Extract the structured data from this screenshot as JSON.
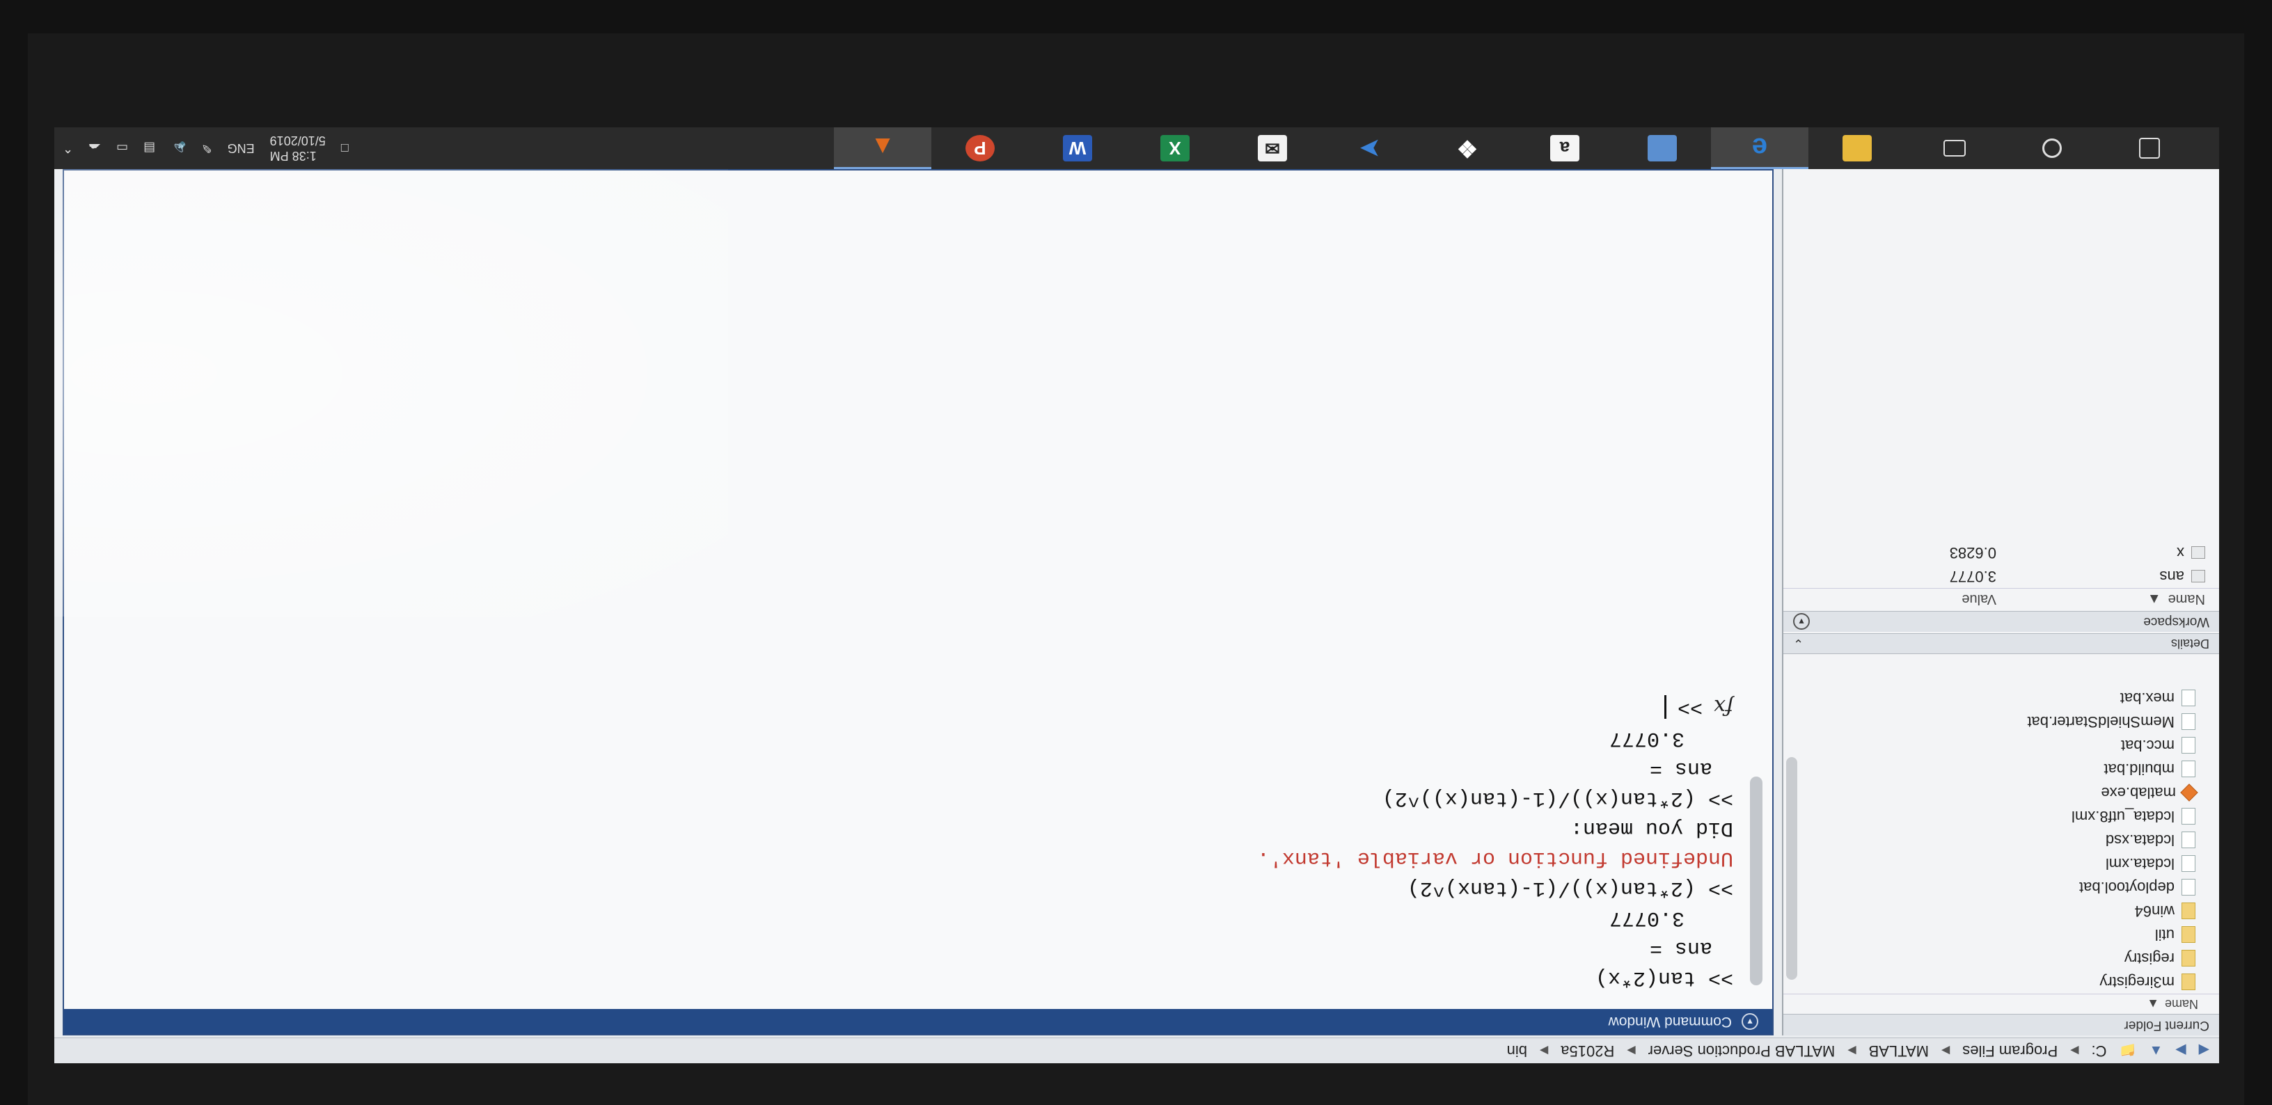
{
  "address": {
    "crumbs": [
      "C:",
      "Program Files",
      "MATLAB",
      "MATLAB Production Server",
      "R2015a",
      "bin"
    ]
  },
  "left": {
    "current_folder_title": "Current Folder",
    "col_name": "Name",
    "files": [
      {
        "name": "m3iregistry",
        "type": "folder"
      },
      {
        "name": "registry",
        "type": "folder"
      },
      {
        "name": "util",
        "type": "folder"
      },
      {
        "name": "win64",
        "type": "folder"
      },
      {
        "name": "deploytool.bat",
        "type": "file"
      },
      {
        "name": "lcdata.xml",
        "type": "file"
      },
      {
        "name": "lcdata.xsd",
        "type": "file"
      },
      {
        "name": "lcdata_utf8.xml",
        "type": "file"
      },
      {
        "name": "matlab.exe",
        "type": "exe"
      },
      {
        "name": "mbuild.bat",
        "type": "file"
      },
      {
        "name": "mcc.bat",
        "type": "file"
      },
      {
        "name": "MemShieldStarter.bat",
        "type": "file"
      },
      {
        "name": "mex.bat",
        "type": "file"
      }
    ],
    "details_label": "Details",
    "workspace_title": "Workspace",
    "ws_col_name": "Name",
    "ws_col_value": "Value",
    "variables": [
      {
        "name": "ans",
        "value": "3.0777"
      },
      {
        "name": "x",
        "value": "0.6283"
      }
    ]
  },
  "command_window": {
    "title": "Command Window",
    "lines": [
      {
        "text": ">> tan(2*x)",
        "kind": "input"
      },
      {
        "text": "ans =",
        "kind": "ind2"
      },
      {
        "text": "3.0777",
        "kind": "ind"
      },
      {
        "text": ">> (2*tan(x))/(1-(tanx)^2)",
        "kind": "input"
      },
      {
        "text": "Undefined function or variable 'tanx'.",
        "kind": "err"
      },
      {
        "text": "Did you mean:",
        "kind": "input"
      },
      {
        "text": ">> (2*tan(x))/(1-(tan(x))^2)",
        "kind": "input"
      },
      {
        "text": "ans =",
        "kind": "ind2"
      },
      {
        "text": "3.0777",
        "kind": "ind"
      }
    ],
    "prompt": ">>",
    "fx": "fx"
  },
  "taskbar": {
    "apps": [
      {
        "icon": "start-icon",
        "glyph": "",
        "color": "#3a3a3a"
      },
      {
        "icon": "search-icon",
        "glyph": "",
        "color": "#3a3a3a"
      },
      {
        "icon": "task-view-icon",
        "glyph": "",
        "color": "#3a3a3a"
      },
      {
        "icon": "file-explorer-icon",
        "glyph": "",
        "color": "#e8b93c"
      },
      {
        "icon": "edge-icon",
        "glyph": "e",
        "color": "#2c7fd6"
      },
      {
        "icon": "store-icon",
        "glyph": "",
        "color": "#5b8fd0"
      },
      {
        "icon": "amazon-icon",
        "glyph": "a",
        "color": "#f5f5f5"
      },
      {
        "icon": "dropbox-icon",
        "glyph": "",
        "color": "#2d6fd6"
      },
      {
        "icon": "visual-studio-icon",
        "glyph": "",
        "color": "#3a82d8"
      },
      {
        "icon": "mail-icon",
        "glyph": "",
        "color": "#f2f2f2"
      },
      {
        "icon": "excel-icon",
        "glyph": "X",
        "color": "#1f8a4c"
      },
      {
        "icon": "word-icon",
        "glyph": "W",
        "color": "#2b5bb8"
      },
      {
        "icon": "powerpoint-icon",
        "glyph": "P",
        "color": "#d0472d"
      },
      {
        "icon": "matlab-icon",
        "glyph": "",
        "color": "#e06a1e"
      }
    ],
    "time": "1:38 PM",
    "date": "5/10/2019",
    "lang": "ENG"
  }
}
